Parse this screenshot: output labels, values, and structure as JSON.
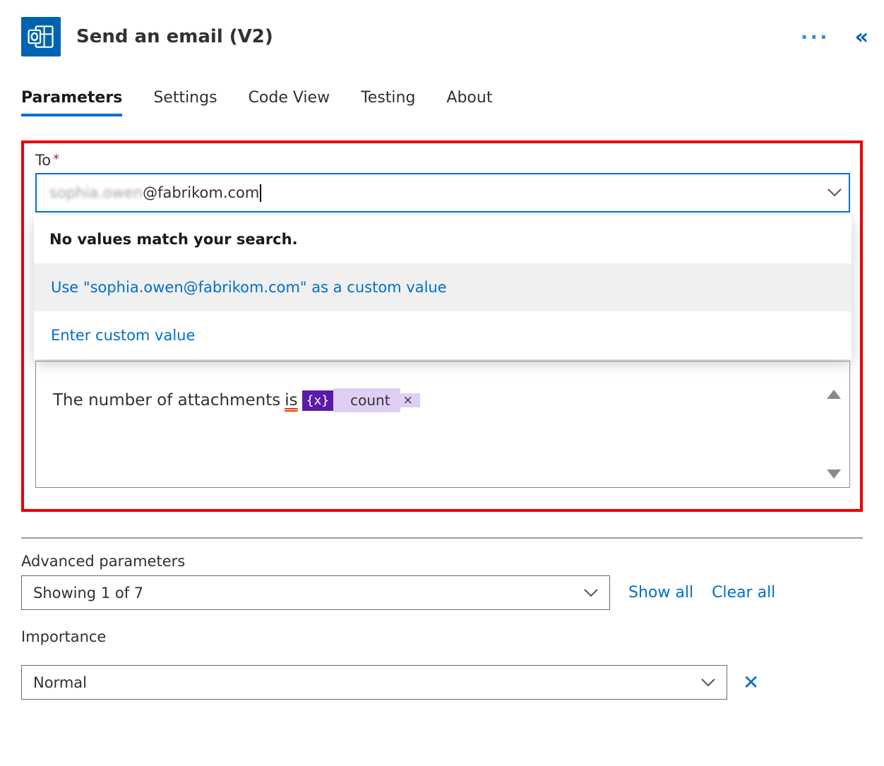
{
  "header": {
    "title": "Send an email (V2)"
  },
  "tabs": {
    "parameters": "Parameters",
    "settings": "Settings",
    "codeview": "Code View",
    "testing": "Testing",
    "about": "About"
  },
  "form": {
    "to_label": "To",
    "to_blur": "sophia.owen",
    "to_rest": "@fabrikom.com",
    "dropdown": {
      "no_match": "No values match your search.",
      "use_custom": "Use \"sophia.owen@fabrikom.com\" as a custom value",
      "enter_custom": "Enter custom value"
    },
    "body_prefix": "The number of attachments ",
    "body_is": "is",
    "fx_icon": "{x}",
    "fx_label": "count",
    "fx_close": "×"
  },
  "advanced": {
    "section_label": "Advanced parameters",
    "showing": "Showing 1 of 7",
    "show_all": "Show all",
    "clear_all": "Clear all",
    "importance_label": "Importance",
    "importance_value": "Normal"
  }
}
